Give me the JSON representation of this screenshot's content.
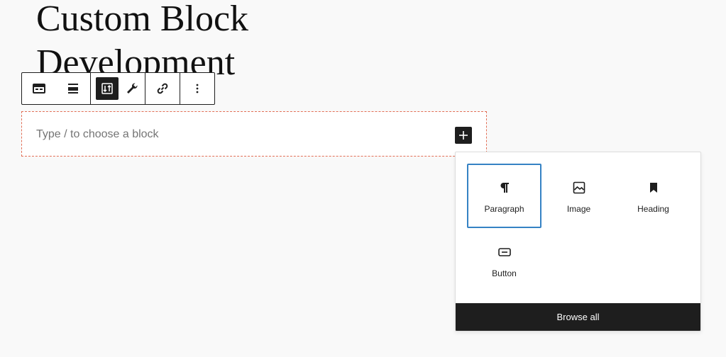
{
  "post": {
    "title": "Custom Block Development"
  },
  "toolbar": {
    "items": [
      {
        "name": "block-type-icon"
      },
      {
        "name": "align-icon"
      },
      {
        "name": "block-move-icon"
      },
      {
        "name": "wrench-icon"
      },
      {
        "name": "link-icon"
      },
      {
        "name": "more-options-icon"
      }
    ]
  },
  "placeholder": {
    "text": "Type / to choose a block",
    "add_icon": "plus-icon"
  },
  "inserter": {
    "blocks": [
      {
        "label": "Paragraph",
        "icon": "paragraph-icon",
        "selected": true
      },
      {
        "label": "Image",
        "icon": "image-icon"
      },
      {
        "label": "Heading",
        "icon": "bookmark-icon"
      },
      {
        "label": "Button",
        "icon": "button-icon"
      }
    ],
    "browse_all_label": "Browse all"
  },
  "colors": {
    "accent": "#3582c4",
    "dark": "#1e1e1e",
    "placeholder_border": "#e26f56"
  }
}
